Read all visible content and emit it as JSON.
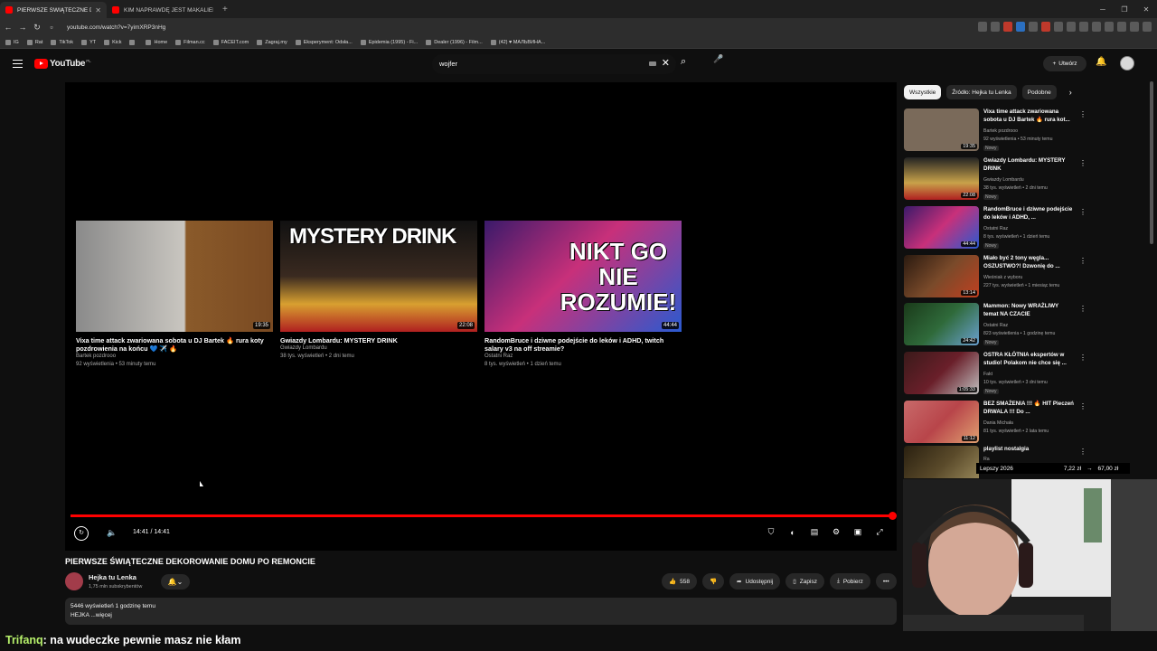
{
  "browser": {
    "tabs": [
      {
        "title": "PIERWSZE ŚWIĄTECZNE DEKOR",
        "active": true
      },
      {
        "title": "KIM NAPRAWDĘ JEST MAKALIER? W",
        "active": false
      }
    ],
    "url": "youtube.com/watch?v=7yimXRP3nHg",
    "bookmarks": [
      "IG",
      "Rat",
      "TikTok",
      "YT",
      "Kick",
      "",
      "Home",
      "Filman.cc",
      "FACEIT.com",
      "Zagraj.my",
      "Eksperyment: Odsła...",
      "Epidemia (1995) - Fi...",
      "Dealer (1996) - Film...",
      "(42) ♥ МАЛЬВИНА..."
    ]
  },
  "youtube": {
    "logo": "YouTube",
    "country": "PL",
    "search_query": "wojfer",
    "create_label": "Utwórz"
  },
  "player": {
    "time": "14:41 / 14:41",
    "end_cards": [
      {
        "title": "Vixa time attack zwariowana sobota u DJ Bartek 🔥 rura koty pozdrowienia na końcu 💙 ✈️ 🔥",
        "channel": "Bartek pozdrooo",
        "meta": "92 wyświetlenia • 53 minuty temu",
        "duration": "19:35"
      },
      {
        "title": "Gwiazdy Lombardu: MYSTERY DRINK",
        "channel": "Gwiazdy Lombardu",
        "meta": "38 tys. wyświetleń • 2 dni temu",
        "duration": "22:08",
        "overlay": "MYSTERY DRINK"
      },
      {
        "title": "RandomBruce i dziwne podejście do leków i ADHD, twitch salary v3 na off streamie?",
        "channel": "Ostatni Raz",
        "meta": "8 tys. wyświetleń • 1 dzień temu",
        "duration": "44:44",
        "overlay": "NIKT GO NIE ROZUMIE!"
      }
    ]
  },
  "video": {
    "title": "PIERWSZE ŚWIĄTECZNE DEKOROWANIE DOMU PO REMONCIE",
    "channel": "Hejka tu Lenka",
    "subscribers": "1,75 mln subskrybentów",
    "likes": "558",
    "share": "Udostępnij",
    "save": "Zapisz",
    "download": "Pobierz",
    "stats": "5446 wyświetleń  1 godzinę temu",
    "desc": "HEJKA ...więcej"
  },
  "sidebar": {
    "chips": [
      "Wszystkie",
      "Źródło: Hejka tu Lenka",
      "Podobne"
    ],
    "items": [
      {
        "title": "Vixa time attack zwariowana sobota u DJ Bartek 🔥 rura kot...",
        "channel": "Bartek pozdrooo",
        "meta": "92 wyświetlenia • 53 minuty temu",
        "badge": "Nowy",
        "duration": "19:35",
        "color": "#7a6a5a"
      },
      {
        "title": "Gwiazdy Lombardu: MYSTERY DRINK",
        "channel": "Gwiazdy Lombardu",
        "meta": "38 tys. wyświetleń • 2 dni temu",
        "badge": "Nowy",
        "duration": "22:08",
        "color": "#c8a24a"
      },
      {
        "title": "RandomBruce i dziwne podejście do leków i ADHD, ...",
        "channel": "Ostatni Raz",
        "meta": "8 tys. wyświetleń • 1 dzień temu",
        "badge": "Nowy",
        "duration": "44:44",
        "color": "#8a3fb0"
      },
      {
        "title": "Miało być 2 tony węgla... OSZUSTWO?! Dzwonię do ...",
        "channel": "Wieśniak z wyboru",
        "meta": "227 tys. wyświetleń • 1 miesiąc temu",
        "badge": "",
        "duration": "13:14",
        "color": "#5a3a2a"
      },
      {
        "title": "Mammon: Nowy WRAŻLIWY temat NA CZACIE",
        "channel": "Ostatni Raz",
        "meta": "823 wyświetlenia • 1 godzinę temu",
        "badge": "Nowy",
        "duration": "24:42",
        "color": "#2f6a3a"
      },
      {
        "title": "OSTRA KŁÓTNIA ekspertów w studio! Polakom nie chce się ...",
        "channel": "Fakt",
        "meta": "10 tys. wyświetleń • 3 dni temu",
        "badge": "Nowy",
        "duration": "1:05:33",
        "color": "#6a1f2a"
      },
      {
        "title": "BEZ SMAŻENIA !!! 🔥 HIT Pieczeń DRWALA !!! Do ...",
        "channel": "Dania Michała",
        "meta": "81 tys. wyświetleń • 2 lata temu",
        "badge": "",
        "duration": "11:12",
        "color": "#b8454a"
      },
      {
        "title": "playlist nostalgia",
        "channel": "Ra",
        "meta": "",
        "badge": "",
        "duration": "",
        "color": "#5a4a2a"
      }
    ]
  },
  "overlay": {
    "label": "Lepszy 2026",
    "amount1": "7,22 zł",
    "amount2": "67,00 zł"
  },
  "chat": {
    "user": "Trifanq",
    "message": ": na wudeczke pewnie masz nie kłam"
  }
}
